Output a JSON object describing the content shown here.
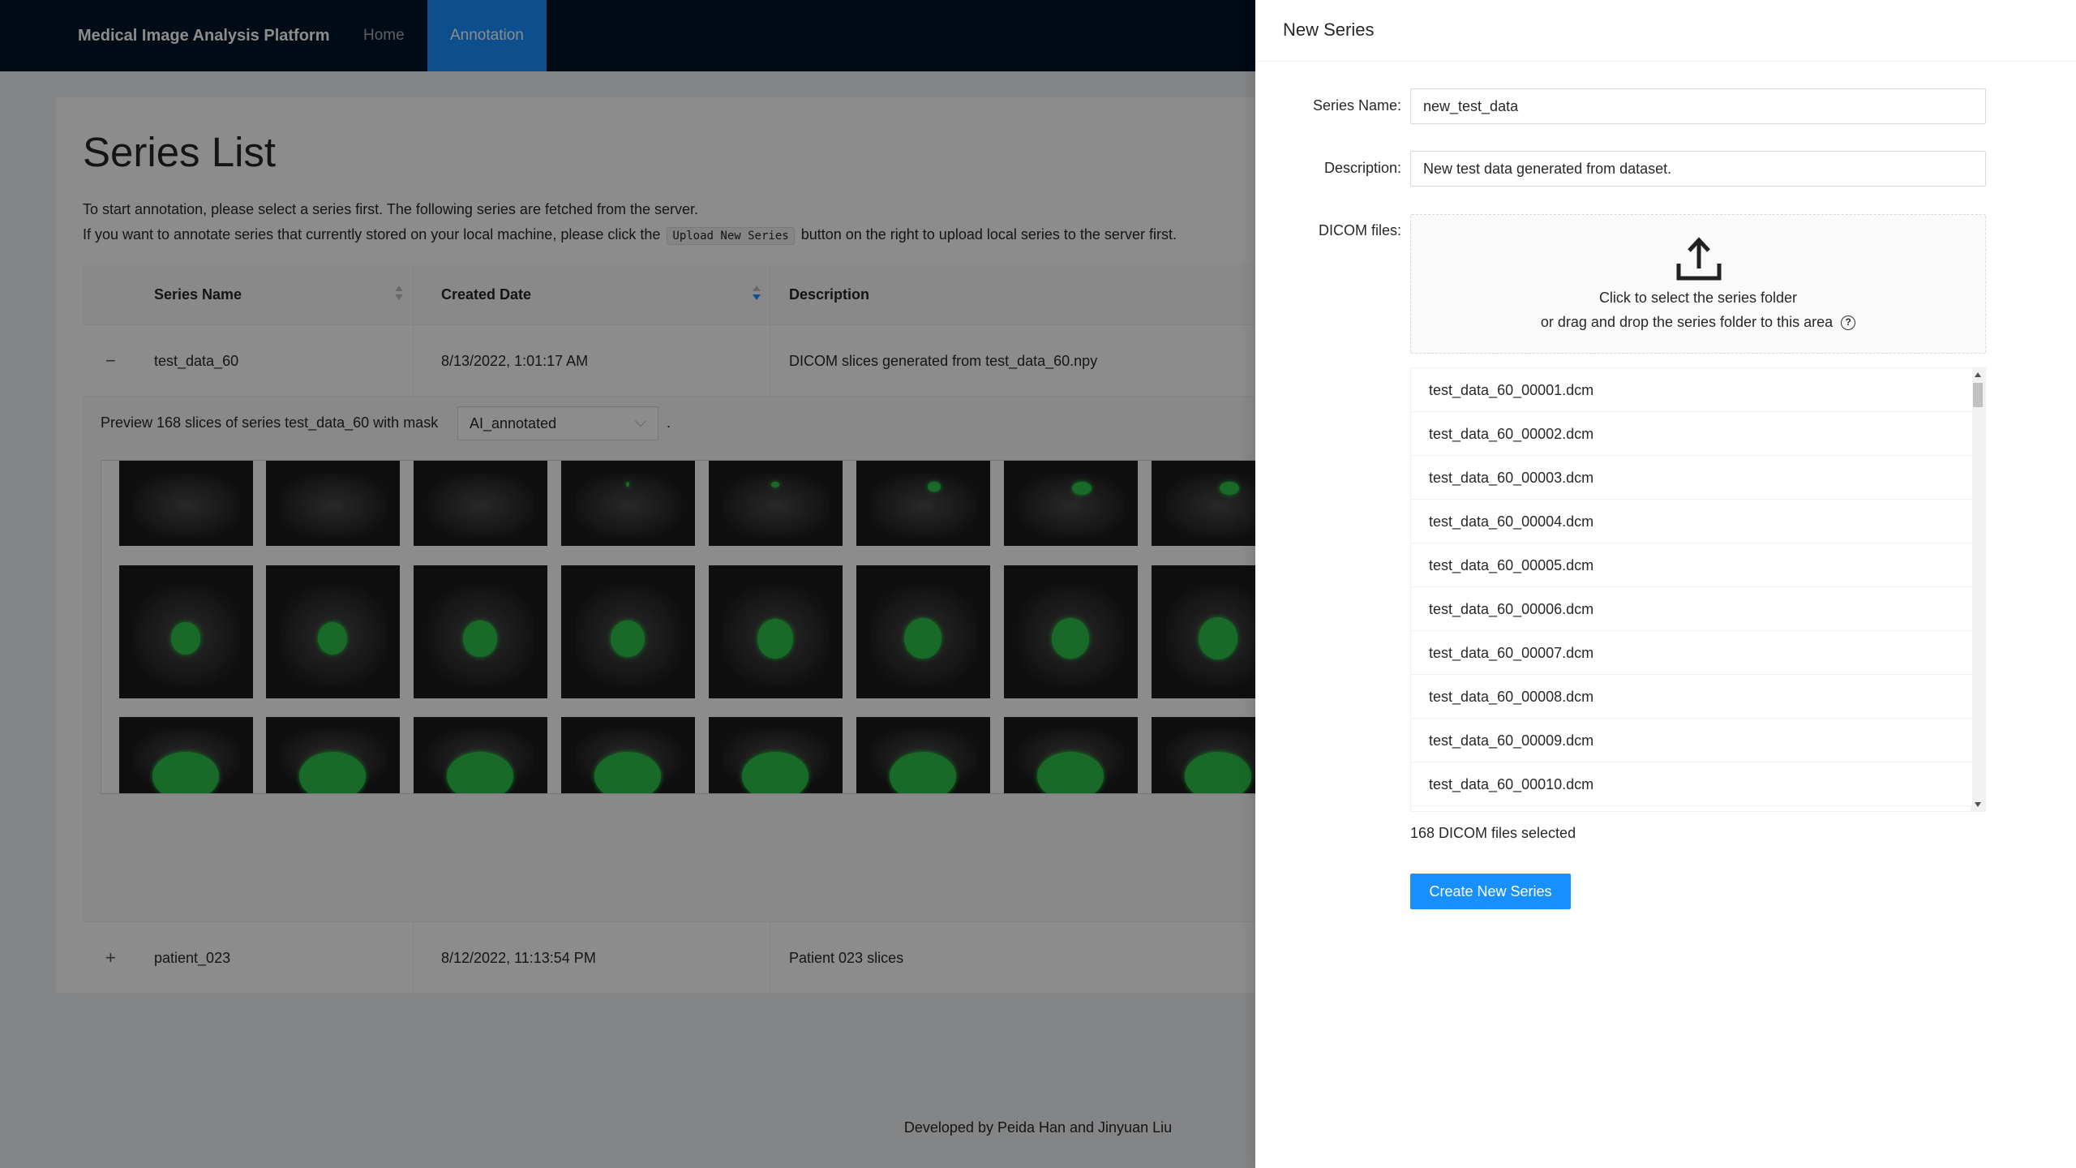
{
  "header": {
    "brand": "Medical Image Analysis Platform",
    "nav": [
      {
        "label": "Home",
        "active": false
      },
      {
        "label": "Annotation",
        "active": true
      }
    ]
  },
  "page": {
    "title": "Series List",
    "intro_line1": "To start annotation, please select a series first. The following series are fetched from the server.",
    "intro_line2_before": "If you want to annotate series that currently stored on your local machine, please click the",
    "intro_code": "Upload New Series",
    "intro_line2_after": "button on the right to upload local series to the server first."
  },
  "table": {
    "columns": [
      "Series Name",
      "Created Date",
      "Description"
    ],
    "rows": [
      {
        "expand_icon": "−",
        "name": "test_data_60",
        "date": "8/13/2022, 1:01:17 AM",
        "description": "DICOM slices generated from test_data_60.npy",
        "expanded": true
      },
      {
        "expand_icon": "+",
        "name": "patient_023",
        "date": "8/12/2022, 11:13:54 PM",
        "description": "Patient 023 slices",
        "expanded": false
      }
    ]
  },
  "preview": {
    "text": "Preview 168 slices of series test_data_60 with mask",
    "mask_value": "AI_annotated",
    "dot": "."
  },
  "footer": {
    "text": "Developed by Peida Han and Jinyuan Liu"
  },
  "drawer": {
    "title": "New Series",
    "series_name_label": "Series Name:",
    "series_name_value": "new_test_data",
    "description_label": "Description:",
    "description_value": "New test data generated from dataset.",
    "dicom_label": "DICOM files:",
    "dropzone_line1": "Click to select the series folder",
    "dropzone_line2": "or drag and drop the series folder to this area",
    "files": [
      "test_data_60_00001.dcm",
      "test_data_60_00002.dcm",
      "test_data_60_00003.dcm",
      "test_data_60_00004.dcm",
      "test_data_60_00005.dcm",
      "test_data_60_00006.dcm",
      "test_data_60_00007.dcm",
      "test_data_60_00008.dcm",
      "test_data_60_00009.dcm",
      "test_data_60_00010.dcm"
    ],
    "file_count": "168 DICOM files selected",
    "create_button": "Create New Series"
  },
  "colors": {
    "header_bg": "#001529",
    "accent": "#1890ff",
    "mask_green": "#2ec24a"
  }
}
